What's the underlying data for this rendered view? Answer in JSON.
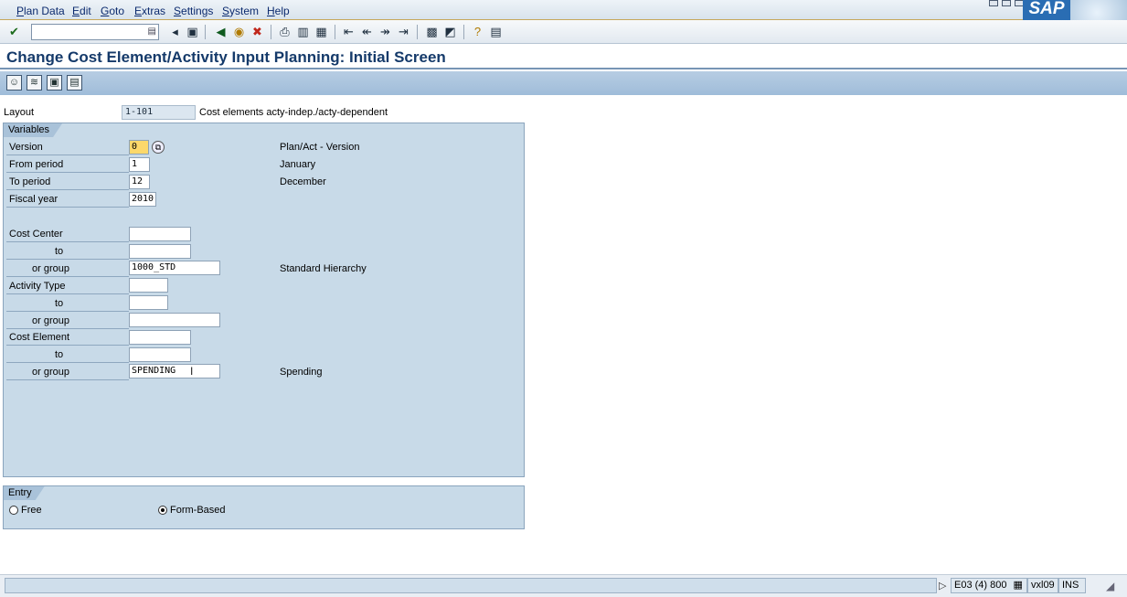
{
  "menu": {
    "items": [
      "Plan Data",
      "Edit",
      "Goto",
      "Extras",
      "Settings",
      "System",
      "Help"
    ]
  },
  "brand": {
    "logo_text": "SAP"
  },
  "toolbar": {
    "command_field_value": "",
    "icons": [
      "enter-icon",
      "back-icon",
      "exit-icon",
      "cancel-icon",
      "print-icon",
      "find-icon",
      "find-next-icon",
      "first-page-icon",
      "previous-page-icon",
      "next-page-icon",
      "last-page-icon",
      "create-session-icon",
      "shortcut-icon",
      "help-icon",
      "layout-menu-icon"
    ]
  },
  "header": {
    "title": "Change Cost Element/Activity Input Planning: Initial Screen"
  },
  "layout": {
    "label": "Layout",
    "value": "1-101",
    "description": "Cost elements acty-indep./acty-dependent"
  },
  "variables": {
    "title": "Variables",
    "version": {
      "label": "Version",
      "value": "0",
      "description": "Plan/Act - Version"
    },
    "from_period": {
      "label": "From period",
      "value": "1",
      "description": "January"
    },
    "to_period": {
      "label": "To period",
      "value": "12",
      "description": "December"
    },
    "fiscal_year": {
      "label": "Fiscal year",
      "value": "2010"
    },
    "cost_center": {
      "label": "Cost Center",
      "from": "",
      "to_label": "to",
      "to": "",
      "group_label": "or group",
      "group": "1000_STD",
      "group_description": "Standard Hierarchy"
    },
    "activity_type": {
      "label": "Activity Type",
      "from": "",
      "to_label": "to",
      "to": "",
      "group_label": "or group",
      "group": ""
    },
    "cost_element": {
      "label": "Cost Element",
      "from": "",
      "to_label": "to",
      "to": "",
      "group_label": "or group",
      "group": "SPENDING",
      "group_description": "Spending"
    }
  },
  "entry": {
    "title": "Entry",
    "options": [
      {
        "label": "Free",
        "selected": false
      },
      {
        "label": "Form-Based",
        "selected": true
      }
    ]
  },
  "status": {
    "system": "E03 (4) 800",
    "client_host": "vxl09",
    "mode": "INS"
  },
  "colors": {
    "title_text": "#153a6a",
    "groupbox_bg": "#c8dae8",
    "app_toolbar": "#a9c2d9",
    "required_field": "#fcd86b"
  }
}
